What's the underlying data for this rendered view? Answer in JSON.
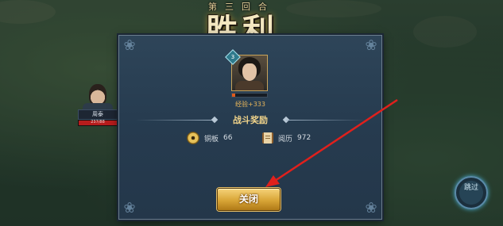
{
  "colors": {
    "panel_bg": "#263b4f",
    "gold_text": "#f0d38a",
    "exp_text": "#e7b55a",
    "button_gold": "#d8a536",
    "arrow_red": "#e0201c"
  },
  "title": {
    "round_label": "第三回合",
    "victory": "胜利"
  },
  "side_character": {
    "name": "周泰",
    "hp_text": "237/88",
    "hp_fraction": 1.0
  },
  "portrait": {
    "level_badge": "3",
    "exp_fraction": 0.1,
    "exp_text": "经验+333"
  },
  "rewards": {
    "section_title": "战斗奖励",
    "items": [
      {
        "icon": "coin-icon",
        "label": "铜板",
        "value": "66"
      },
      {
        "icon": "scroll-icon",
        "label": "阅历",
        "value": "972"
      }
    ]
  },
  "buttons": {
    "close_label": "关闭",
    "skip_label": "跳过"
  }
}
